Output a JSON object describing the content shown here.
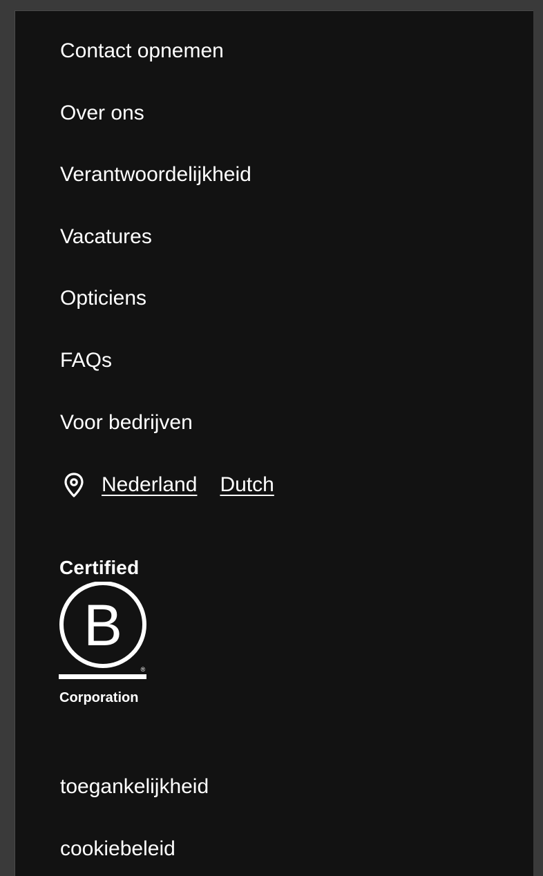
{
  "menu": {
    "items": [
      {
        "label": "Contact opnemen"
      },
      {
        "label": "Over ons"
      },
      {
        "label": "Verantwoordelijkheid"
      },
      {
        "label": "Vacatures"
      },
      {
        "label": "Opticiens"
      },
      {
        "label": "FAQs"
      },
      {
        "label": "Voor bedrijven"
      }
    ]
  },
  "locale": {
    "icon": "location-pin-icon",
    "country": "Nederland",
    "language": "Dutch"
  },
  "bcorp": {
    "top_text": "Certified",
    "letter": "B",
    "registered_mark": "®",
    "bottom_text": "Corporation"
  },
  "legal": {
    "items": [
      {
        "label": "toegankelijkheid"
      },
      {
        "label": "cookiebeleid"
      }
    ]
  },
  "colors": {
    "background": "#121212",
    "text": "#ffffff",
    "outer": "#3a3a3a"
  }
}
